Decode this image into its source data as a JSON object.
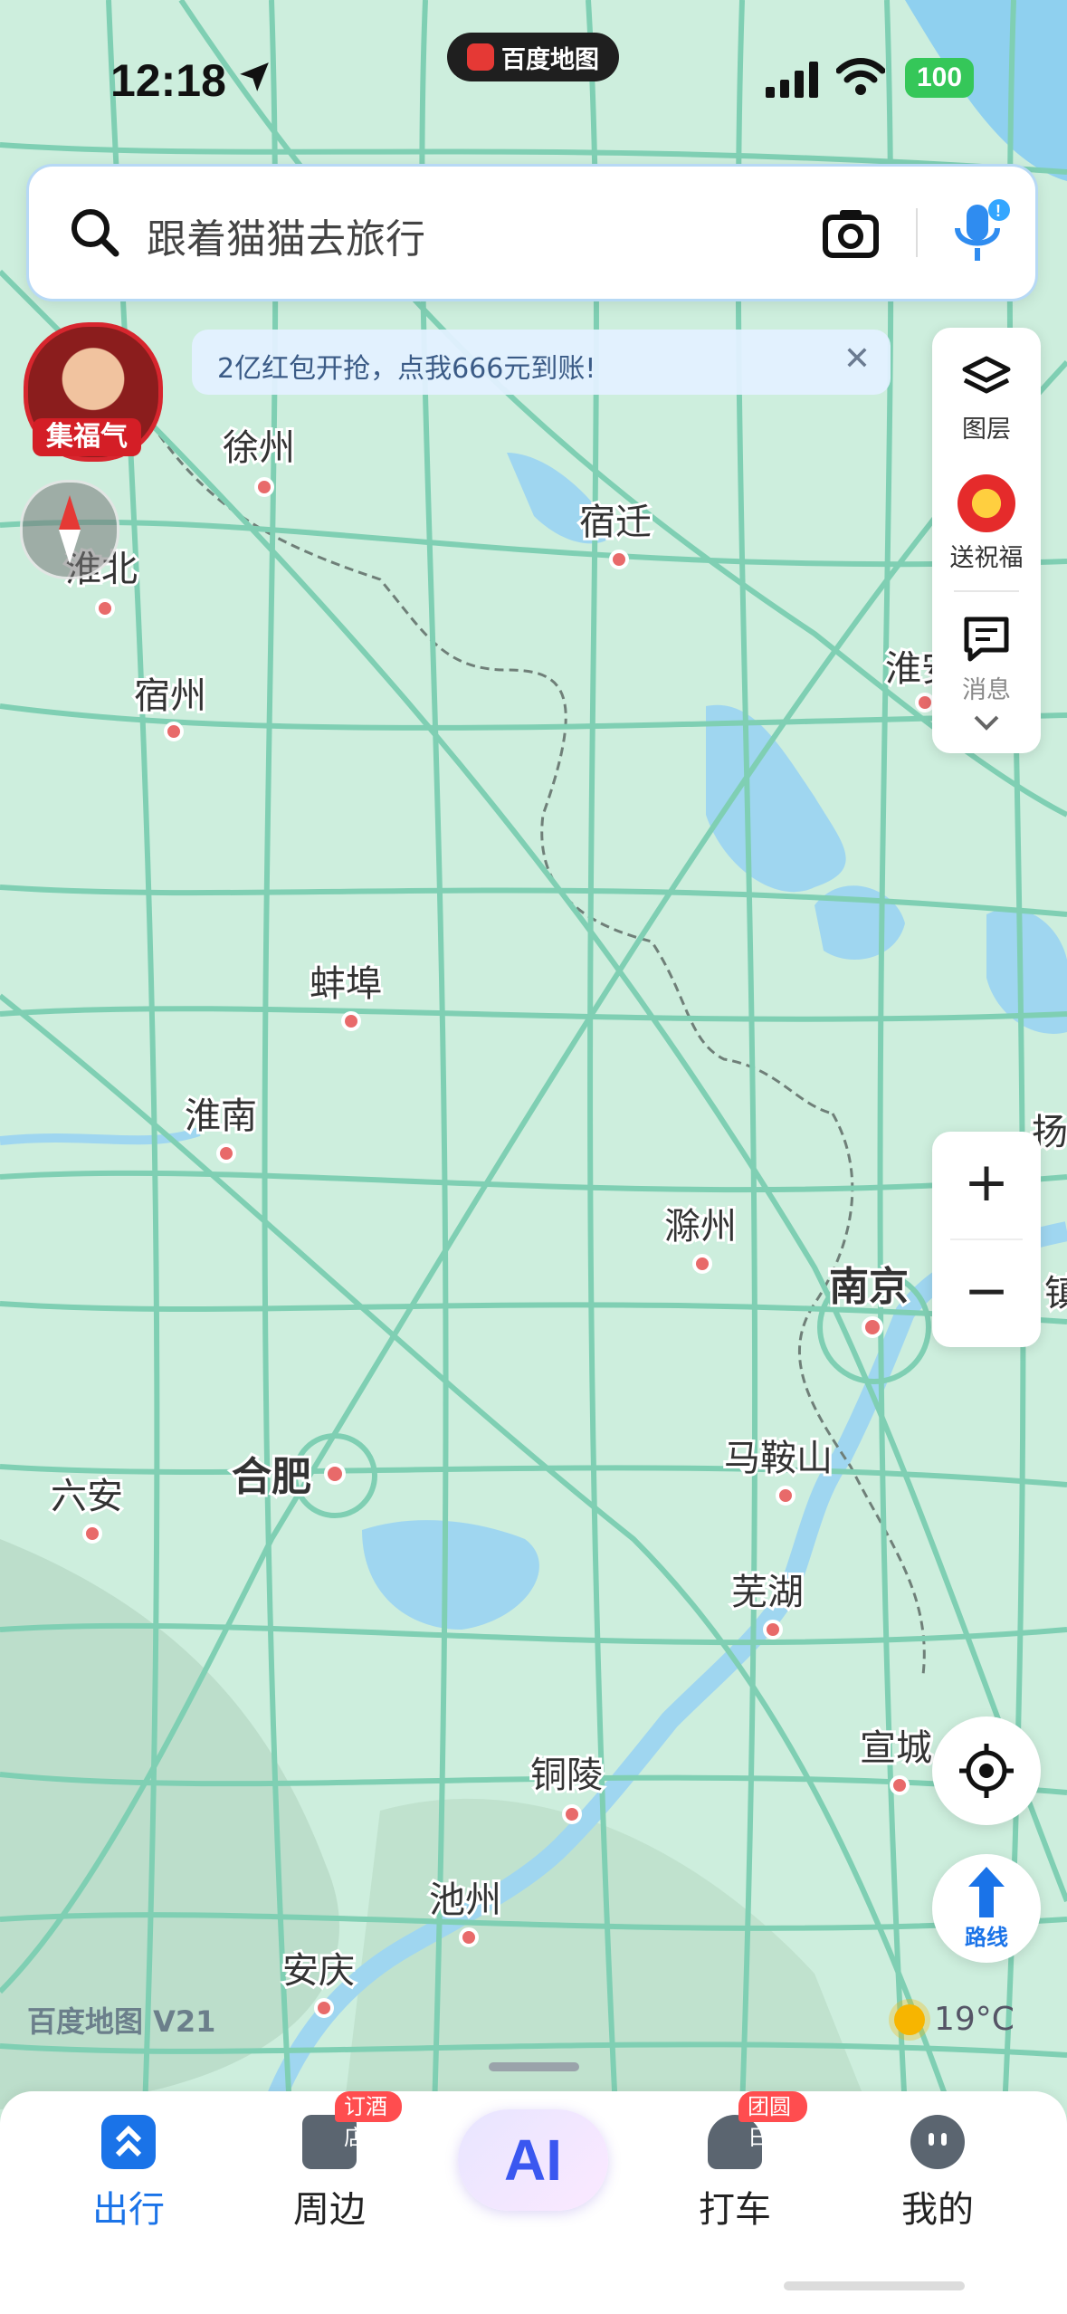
{
  "status_bar": {
    "time": "12:18",
    "app_pill": "百度地图",
    "battery": "100"
  },
  "search": {
    "placeholder": "跟着猫猫去旅行"
  },
  "promo": {
    "text": "2亿红包开抢，点我666元到账!",
    "close": "✕"
  },
  "avatar": {
    "tag": "集福气"
  },
  "side_panel": {
    "layers": "图层",
    "blessing": "送祝福",
    "messages": "消息"
  },
  "zoom": {
    "in": "+",
    "out": "−"
  },
  "route_button": {
    "label": "路线"
  },
  "map": {
    "cities": [
      {
        "name": "徐州"
      },
      {
        "name": "宿迁"
      },
      {
        "name": "淮北"
      },
      {
        "name": "宿州"
      },
      {
        "name": "淮安"
      },
      {
        "name": "蚌埠"
      },
      {
        "name": "淮南"
      },
      {
        "name": "滁州"
      },
      {
        "name": "南京"
      },
      {
        "name": "扬"
      },
      {
        "name": "镇"
      },
      {
        "name": "合肥"
      },
      {
        "name": "六安"
      },
      {
        "name": "马鞍山"
      },
      {
        "name": "芜湖"
      },
      {
        "name": "铜陵"
      },
      {
        "name": "宣城"
      },
      {
        "name": "池州"
      },
      {
        "name": "安庆"
      }
    ],
    "watermark": "百度地图 V21"
  },
  "weather": {
    "temp": "19°C"
  },
  "tabbar": {
    "items": [
      {
        "label": "出行",
        "active": true
      },
      {
        "label": "周边",
        "badge": "订酒店"
      },
      {
        "label": "AI"
      },
      {
        "label": "打车",
        "badge": "团圆日"
      },
      {
        "label": "我的"
      }
    ]
  },
  "colors": {
    "accent": "#1a73e8",
    "map_land": "#cdeedd",
    "road": "#7fcfb3",
    "water": "#9fd6f0",
    "badge": "#ff4d4f"
  }
}
